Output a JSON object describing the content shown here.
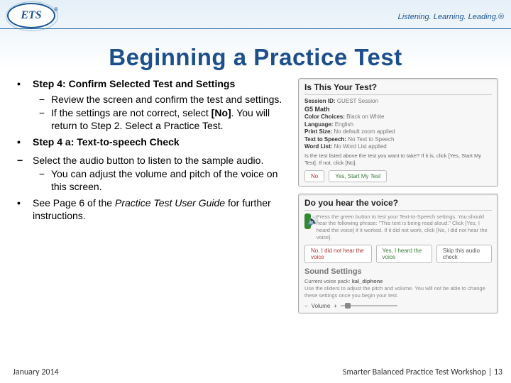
{
  "header": {
    "logo_text": "ETS",
    "tagline": "Listening. Learning. Leading.®"
  },
  "title": "Beginning a Practice Test",
  "left": {
    "r1": {
      "tick": "•",
      "heading": "Step 4: Confirm Selected Test and Settings",
      "sub": [
        {
          "dash": "−",
          "text": "Review the screen and confirm the test and settings."
        },
        {
          "dash": "−",
          "text": "If the settings are not correct, select [No]. You will return to Step 2. Select a Practice Test."
        }
      ]
    },
    "r2": {
      "tick": "•",
      "heading": "Step 4 a: Text-to-speech Check"
    },
    "r3": {
      "tick": "−",
      "text": "Select the audio button to listen to the sample audio.",
      "sub": [
        {
          "dash": "−",
          "text": "You can adjust the volume and pitch of the voice on this screen."
        }
      ]
    },
    "r4": {
      "tick": "•",
      "text_pre": "See Page 6 of the ",
      "text_em": "Practice Test User Guide ",
      "text_post": "for further instructions."
    }
  },
  "panel1": {
    "title": "Is This Your Test?",
    "rows": [
      {
        "k": "Session ID:",
        "v": "GUEST Session"
      },
      {
        "k": "G5 Math",
        "v": "",
        "strong": true
      },
      {
        "k": "Color Choices:",
        "v": "Black on White"
      },
      {
        "k": "Language:",
        "v": "English"
      },
      {
        "k": "Print Size:",
        "v": "No default zoom applied"
      },
      {
        "k": "Text to Speech:",
        "v": "No Text to Speech"
      },
      {
        "k": "Word List:",
        "v": "No Word List applied"
      }
    ],
    "question": "Is the test listed above the test you want to take? If it is, click [Yes, Start My Test]. If not, click [No].",
    "btn_no": "No",
    "btn_yes": "Yes, Start My Test"
  },
  "panel2": {
    "title": "Do you hear the voice?",
    "desc": "Press the green button to test your Text-to-Speech settings. You should hear the following phrase: \"This text is being read aloud.\" Click [Yes, I heard the voice] if it worked. If it did not work, click [No, I did not hear the voice].",
    "btn_no": "No, I did not hear the voice",
    "btn_yes": "Yes, I heard the voice",
    "btn_skip": "Skip this audio check",
    "snd_title": "Sound Settings",
    "snd_pack": "Current voice pack: kal_diphone",
    "snd_desc": "Use the sliders to adjust the pitch and volume. You will not be able to change these settings once you begin your test.",
    "vol_label": "Volume"
  },
  "footer": {
    "left": "January 2014",
    "right": "Smarter Balanced Practice Test Workshop | 13"
  }
}
